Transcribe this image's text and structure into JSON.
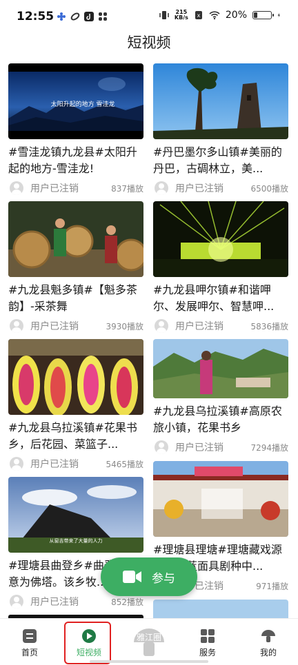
{
  "status_bar": {
    "time": "12:55",
    "net_speed_value": "215",
    "net_speed_unit": "KB/s",
    "battery_percent": "20%",
    "battery_level": 0.2
  },
  "header": {
    "title": "短视频"
  },
  "videos": [
    {
      "title": "#雪洼龙镇九龙县#太阳升起的地方-雪洼龙!",
      "author": "用户已注销",
      "plays": "837播放",
      "thumb_caption": "太阳升起的地方 雪洼龙"
    },
    {
      "title": "#丹巴墨尔多山镇#美丽的丹巴，古碉林立，美...",
      "author": "用户已注销",
      "plays": "6500播放"
    },
    {
      "title": "#九龙县魁多镇#【魁多茶韵】-采茶舞",
      "author": "用户已注销",
      "plays": "3930播放"
    },
    {
      "title": "#九龙县呷尔镇#和谐呷尔、发展呷尔、智慧呷...",
      "author": "用户已注销",
      "plays": "5836播放"
    },
    {
      "title": "#九龙县乌拉溪镇#花果书乡，后花园、菜篮子...",
      "author": "用户已注销",
      "plays": "5465播放"
    },
    {
      "title": "#九龙县乌拉溪镇#高原农旅小镇，花果书乡",
      "author": "用户已注销",
      "plays": "7294播放"
    },
    {
      "title": "#理塘县曲登乡#曲登藏语意为佛塔。该乡牧...",
      "author": "用户已注销",
      "plays": "852播放",
      "thumb_caption": "从窗吉带来了大量的人力"
    },
    {
      "title": "#理塘县理塘#理塘藏戏源于西藏蓝面具剧种中...",
      "author": "用户已注销",
      "plays": "971播放"
    }
  ],
  "fab": {
    "label": "参与"
  },
  "tabs": [
    {
      "label": "首页",
      "icon": "home-icon"
    },
    {
      "label": "短视频",
      "icon": "play-icon",
      "active": true
    },
    {
      "label": "雅江圈",
      "icon": "mushroom-icon"
    },
    {
      "label": "服务",
      "icon": "grid-icon"
    },
    {
      "label": "我的",
      "icon": "mushroom-icon"
    }
  ],
  "colors": {
    "accent": "#3dae63",
    "highlight": "#e02020"
  }
}
